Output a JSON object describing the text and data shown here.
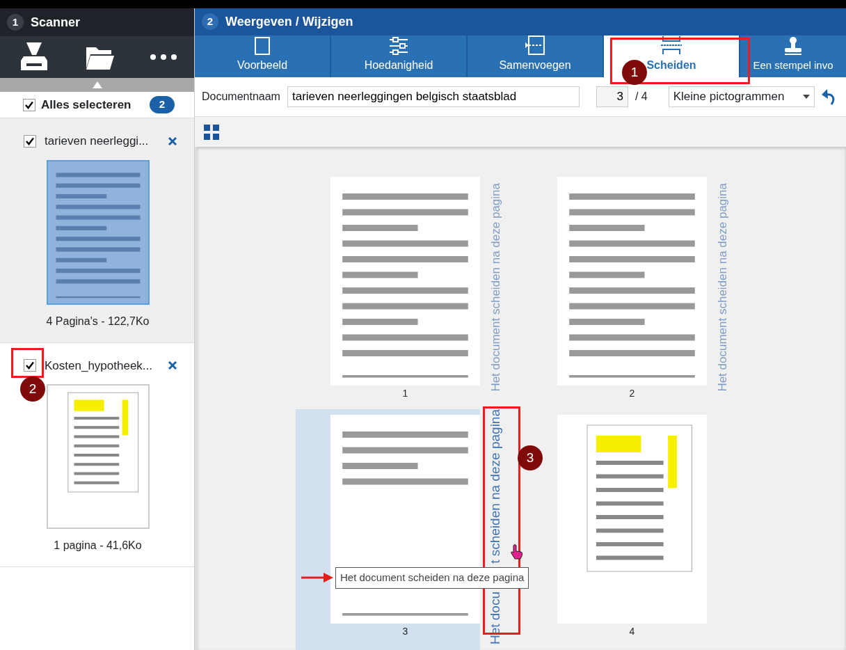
{
  "panels": [
    {
      "number": "1",
      "title": "Scanner"
    },
    {
      "number": "2",
      "title": "Weergeven / Wijzigen"
    }
  ],
  "select_all": {
    "label": "Alles selecteren",
    "checked": true,
    "count": "2"
  },
  "documents": [
    {
      "name": "tarieven neerleggi...",
      "checked": true,
      "selected": true,
      "info": "4 Pagina's - 122,7Ko"
    },
    {
      "name": "Kosten_hypotheek...",
      "checked": true,
      "selected": false,
      "info": "1 pagina - 41,6Ko"
    }
  ],
  "tabs": [
    {
      "label": "Voorbeeld",
      "kind": "preview",
      "selected": false
    },
    {
      "label": "Hoedanigheid",
      "kind": "properties",
      "selected": false
    },
    {
      "label": "Samenvoegen",
      "kind": "merge",
      "selected": false
    },
    {
      "label": "Scheiden",
      "kind": "split",
      "selected": true
    },
    {
      "label": "Een stempel invo",
      "kind": "stamp",
      "selected": false
    }
  ],
  "toolbar": {
    "document_label": "Documentnaam",
    "document_name": "tarieven neerleggingen belgisch staatsblad",
    "page": "3",
    "page_total": "/ 4",
    "view_mode": "Kleine pictogrammen"
  },
  "pages": [
    {
      "number": "1",
      "kind": "text",
      "selected": false,
      "separator": {
        "label": "Het document scheiden na deze pagina",
        "hovered": false
      }
    },
    {
      "number": "2",
      "kind": "text",
      "selected": false,
      "separator": {
        "label": "Het document scheiden na deze pagina",
        "hovered": false
      }
    },
    {
      "number": "3",
      "kind": "short",
      "selected": true,
      "separator": {
        "label_parts": [
          "Het docu",
          "t scheiden na deze pagina"
        ],
        "hovered": true
      }
    },
    {
      "number": "4",
      "kind": "table",
      "selected": false
    }
  ],
  "tooltip": "Het document scheiden na deze pagina",
  "annotations": [
    {
      "number": "1"
    },
    {
      "number": "2"
    },
    {
      "number": "3"
    }
  ]
}
